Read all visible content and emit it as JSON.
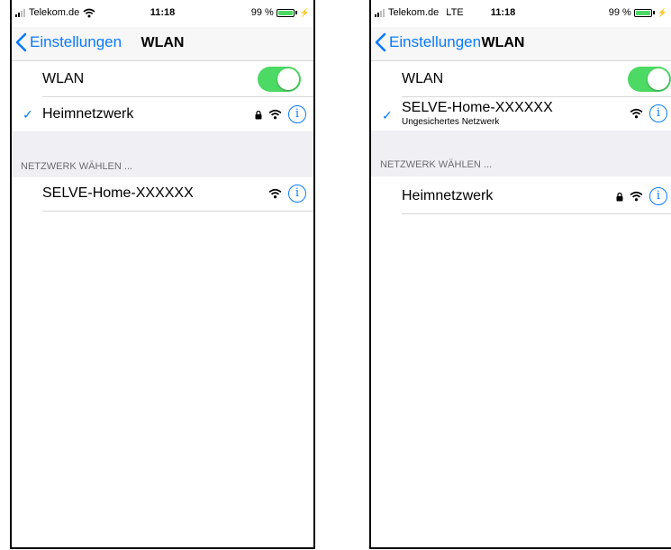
{
  "phones": [
    {
      "status": {
        "carrier": "Telekom.de",
        "network": "",
        "time": "11:18",
        "battery": "99 %"
      },
      "nav": {
        "back_label": "Einstellungen",
        "title": "WLAN"
      },
      "wlan_row": {
        "label": "WLAN",
        "toggle_on": true
      },
      "connected": {
        "name": "Heimnetzwerk",
        "subtitle": "",
        "secured": true
      },
      "section_header": "NETZWERK WÄHLEN ...",
      "networks": [
        {
          "name": "SELVE-Home-XXXXXX",
          "secured": false
        }
      ]
    },
    {
      "status": {
        "carrier": "Telekom.de",
        "network": "LTE",
        "time": "11:18",
        "battery": "99 %"
      },
      "nav": {
        "back_label": "Einstellungen",
        "title": "WLAN"
      },
      "wlan_row": {
        "label": "WLAN",
        "toggle_on": true
      },
      "connected": {
        "name": "SELVE-Home-XXXXXX",
        "subtitle": "Ungesichertes Netzwerk",
        "secured": false
      },
      "section_header": "NETZWERK WÄHLEN ...",
      "networks": [
        {
          "name": "Heimnetzwerk",
          "secured": true
        }
      ]
    }
  ],
  "colors": {
    "accent": "#0a7aff",
    "toggle_on": "#4cd964",
    "group_background": "#efeff4"
  },
  "icons": [
    "signal-icon",
    "wifi-icon",
    "battery-icon",
    "charging-icon",
    "back-chevron-icon",
    "checkmark-icon",
    "lock-icon",
    "info-icon"
  ]
}
